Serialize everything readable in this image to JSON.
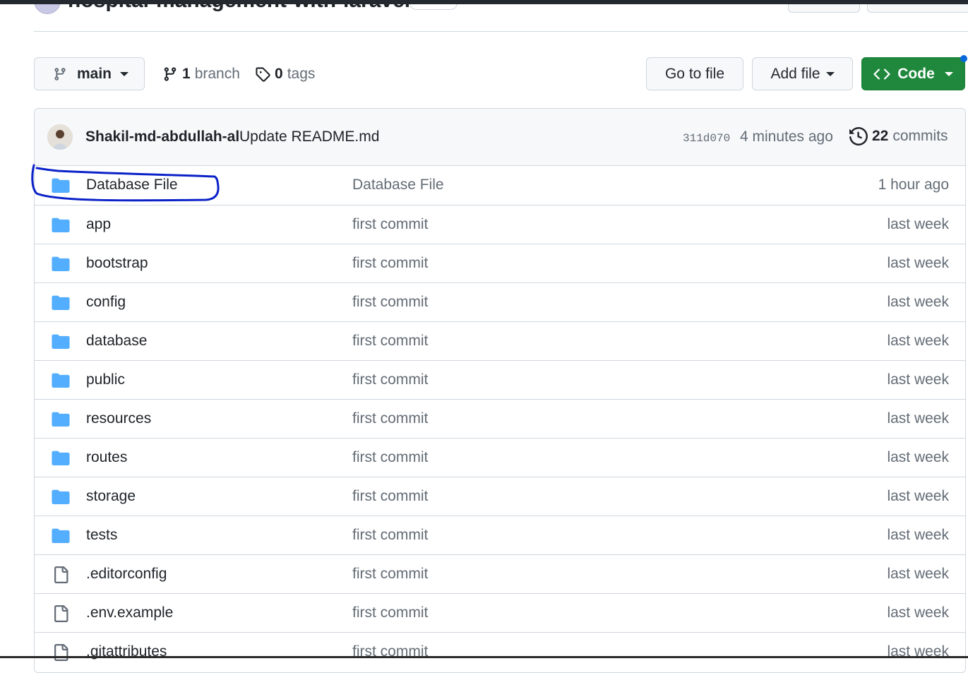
{
  "repo": {
    "title": "hospital-management-with-laravel"
  },
  "toolbar": {
    "branch_label": "main",
    "branches_count": "1",
    "branches_label": "branch",
    "tags_count": "0",
    "tags_label": "tags",
    "goto_file_label": "Go to file",
    "add_file_label": "Add file",
    "code_label": "Code"
  },
  "latest_commit": {
    "author": "Shakil-md-abdullah-al",
    "message": "Update README.md",
    "sha": "311d070",
    "time": "4 minutes ago",
    "commits_count": "22",
    "commits_label": "commits"
  },
  "files": [
    {
      "name": "Database File",
      "type": "folder",
      "message": "Database File",
      "age": "1 hour ago"
    },
    {
      "name": "app",
      "type": "folder",
      "message": "first commit",
      "age": "last week"
    },
    {
      "name": "bootstrap",
      "type": "folder",
      "message": "first commit",
      "age": "last week"
    },
    {
      "name": "config",
      "type": "folder",
      "message": "first commit",
      "age": "last week"
    },
    {
      "name": "database",
      "type": "folder",
      "message": "first commit",
      "age": "last week"
    },
    {
      "name": "public",
      "type": "folder",
      "message": "first commit",
      "age": "last week"
    },
    {
      "name": "resources",
      "type": "folder",
      "message": "first commit",
      "age": "last week"
    },
    {
      "name": "routes",
      "type": "folder",
      "message": "first commit",
      "age": "last week"
    },
    {
      "name": "storage",
      "type": "folder",
      "message": "first commit",
      "age": "last week"
    },
    {
      "name": "tests",
      "type": "folder",
      "message": "first commit",
      "age": "last week"
    },
    {
      "name": ".editorconfig",
      "type": "file",
      "message": "first commit",
      "age": "last week"
    },
    {
      "name": ".env.example",
      "type": "file",
      "message": "first commit",
      "age": "last week"
    },
    {
      "name": ".gitattributes",
      "type": "file",
      "message": "first commit",
      "age": "last week"
    }
  ],
  "colors": {
    "folder": "#54aeff",
    "code_button": "#1f883d",
    "highlight_annotation": "#0a22c8"
  }
}
